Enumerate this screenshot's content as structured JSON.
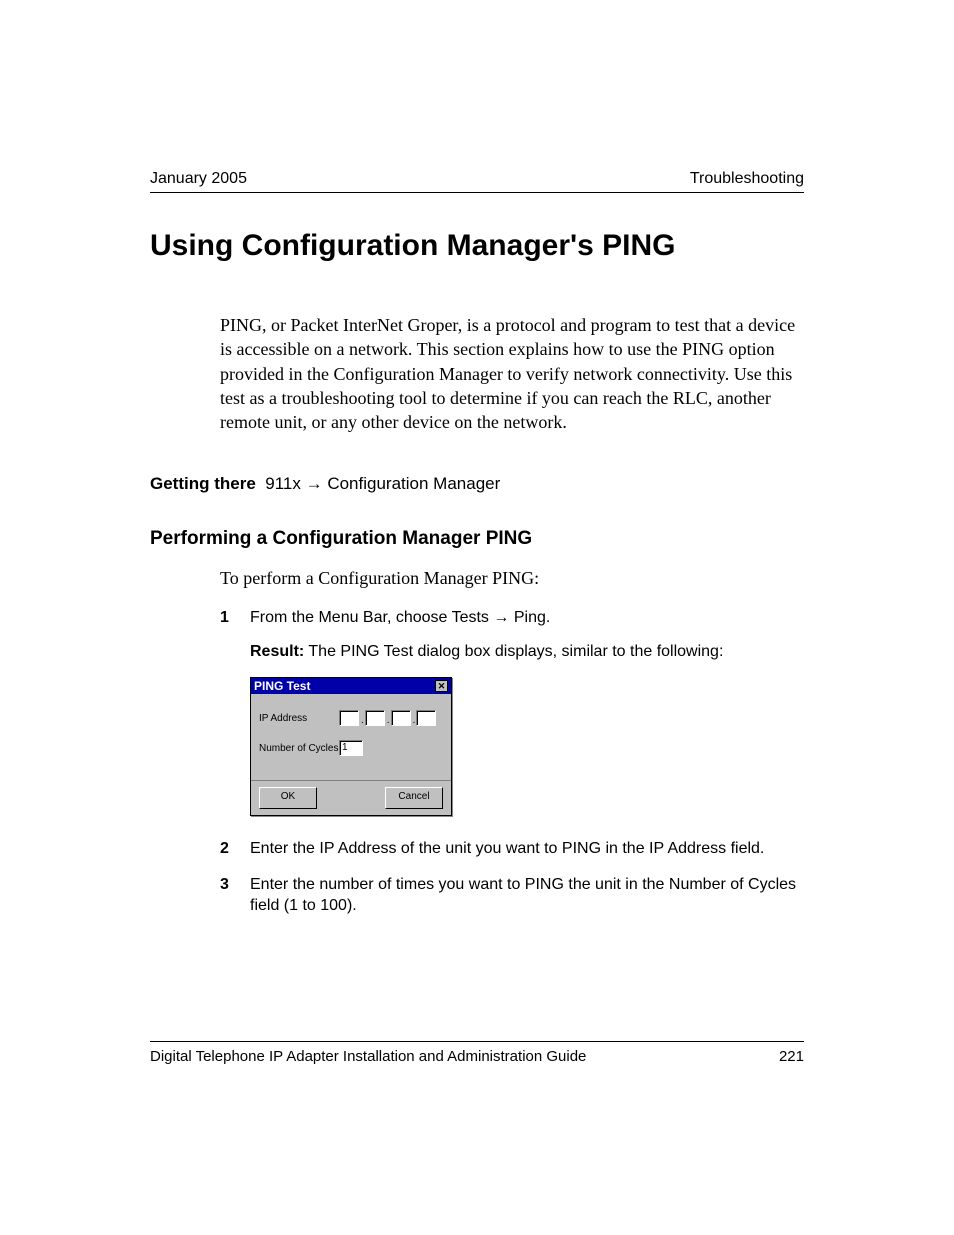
{
  "header": {
    "left": "January 2005",
    "right": "Troubleshooting"
  },
  "title": "Using Configuration Manager's PING",
  "intro": "PING, or Packet InterNet Groper, is a protocol and program to test that a device is accessible on a network. This section explains how to use the PING option provided in the Configuration Manager to verify network connectivity. Use this test as a troubleshooting tool to determine if you can reach the RLC, another remote unit, or any other device on the network.",
  "getting_there": {
    "label": "Getting there",
    "path_before": "911x",
    "arrow": "→",
    "path_after": "Configuration Manager"
  },
  "section_heading": "Performing a Configuration Manager PING",
  "lead": "To perform a Configuration Manager PING:",
  "steps": [
    {
      "num": "1",
      "before": "From the Menu Bar, choose Tests",
      "arrow": "→",
      "after": "Ping."
    },
    {
      "num": "2",
      "text": "Enter the IP Address of the unit you want to PING in the IP Address field."
    },
    {
      "num": "3",
      "text": "Enter the number of times you want to PING the unit in the Number of Cycles field (1 to 100)."
    }
  ],
  "result": {
    "label": "Result:",
    "text": "The PING Test dialog box displays, similar to the following:"
  },
  "dialog": {
    "title": "PING Test",
    "close": "✕",
    "ip_label": "IP Address",
    "dot": ".",
    "cycles_label": "Number of Cycles",
    "cycles_value": "1",
    "ok": "OK",
    "cancel": "Cancel"
  },
  "footer": {
    "left": "Digital Telephone IP Adapter Installation and Administration Guide",
    "right": "221"
  }
}
